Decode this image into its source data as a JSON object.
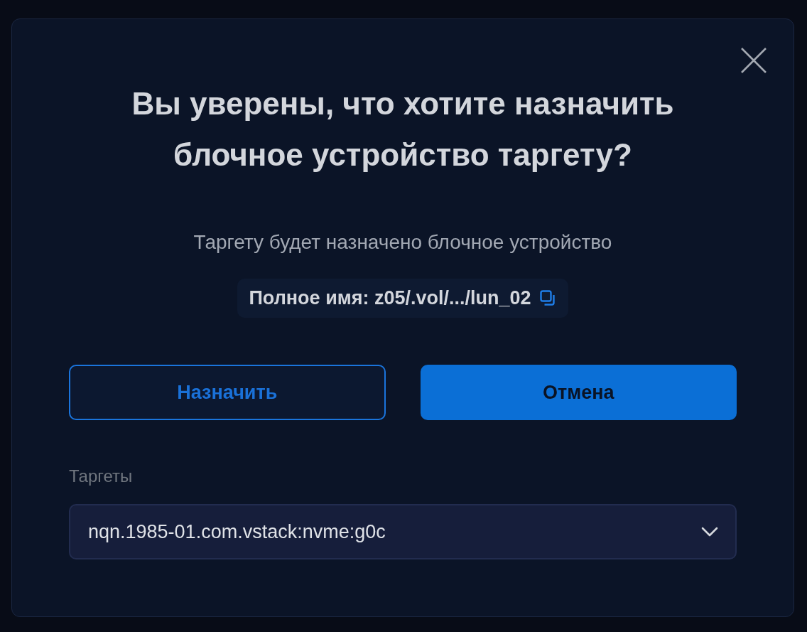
{
  "dialog": {
    "title": "Вы уверены, что хотите назначить блочное устройство таргету?",
    "message": "Таргету будет назначено блочное устройство",
    "full_name": "Полное имя: z05/.vol/.../lun_02",
    "buttons": [
      {
        "label": "Назначить",
        "kind": "outline"
      },
      {
        "label": "Отмена",
        "kind": "primary"
      }
    ],
    "targets": {
      "label": "Таргеты",
      "value": "nqn.1985-01.com.vstack:nvme:g0c"
    }
  }
}
